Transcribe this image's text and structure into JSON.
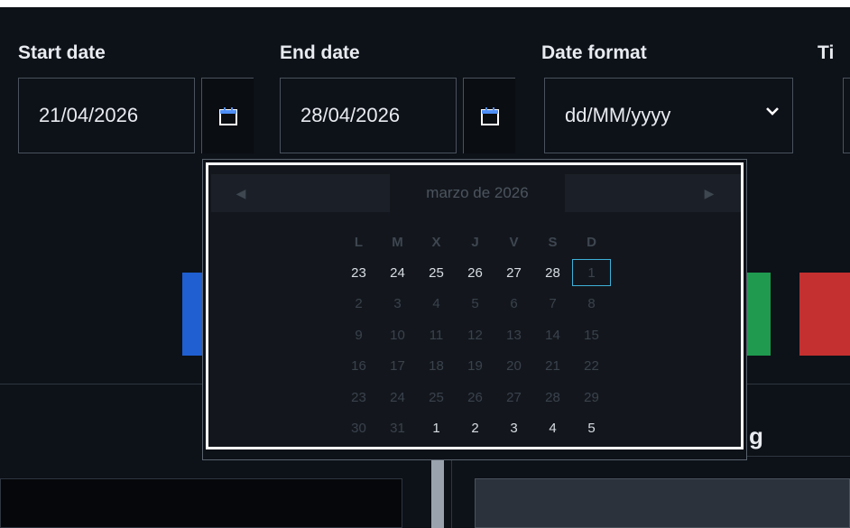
{
  "filters": {
    "start_date": {
      "label": "Start date",
      "value": "21/04/2026"
    },
    "end_date": {
      "label": "End date",
      "value": "28/04/2026"
    },
    "date_format": {
      "label": "Date format",
      "value": "dd/MM/yyyy"
    },
    "time_partial_label": "Ti"
  },
  "datepicker": {
    "month_label": "marzo de 2026",
    "weekdays": [
      "L",
      "M",
      "X",
      "J",
      "V",
      "S",
      "D"
    ],
    "weeks": [
      [
        {
          "d": "23",
          "m": "in"
        },
        {
          "d": "24",
          "m": "in"
        },
        {
          "d": "25",
          "m": "in"
        },
        {
          "d": "26",
          "m": "in"
        },
        {
          "d": "27",
          "m": "in"
        },
        {
          "d": "28",
          "m": "in"
        },
        {
          "d": "1",
          "m": "sel"
        }
      ],
      [
        {
          "d": "2",
          "m": "out"
        },
        {
          "d": "3",
          "m": "out"
        },
        {
          "d": "4",
          "m": "out"
        },
        {
          "d": "5",
          "m": "out"
        },
        {
          "d": "6",
          "m": "out"
        },
        {
          "d": "7",
          "m": "out"
        },
        {
          "d": "8",
          "m": "out"
        }
      ],
      [
        {
          "d": "9",
          "m": "out"
        },
        {
          "d": "10",
          "m": "out"
        },
        {
          "d": "11",
          "m": "out"
        },
        {
          "d": "12",
          "m": "out"
        },
        {
          "d": "13",
          "m": "out"
        },
        {
          "d": "14",
          "m": "out"
        },
        {
          "d": "15",
          "m": "out"
        }
      ],
      [
        {
          "d": "16",
          "m": "out"
        },
        {
          "d": "17",
          "m": "out"
        },
        {
          "d": "18",
          "m": "out"
        },
        {
          "d": "19",
          "m": "out"
        },
        {
          "d": "20",
          "m": "out"
        },
        {
          "d": "21",
          "m": "out"
        },
        {
          "d": "22",
          "m": "out"
        }
      ],
      [
        {
          "d": "23",
          "m": "out"
        },
        {
          "d": "24",
          "m": "out"
        },
        {
          "d": "25",
          "m": "out"
        },
        {
          "d": "26",
          "m": "out"
        },
        {
          "d": "27",
          "m": "out"
        },
        {
          "d": "28",
          "m": "out"
        },
        {
          "d": "29",
          "m": "out"
        }
      ],
      [
        {
          "d": "30",
          "m": "out"
        },
        {
          "d": "31",
          "m": "out"
        },
        {
          "d": "1",
          "m": "in"
        },
        {
          "d": "2",
          "m": "in"
        },
        {
          "d": "3",
          "m": "in"
        },
        {
          "d": "4",
          "m": "in"
        },
        {
          "d": "5",
          "m": "in"
        }
      ]
    ]
  },
  "section_tail_text": "g",
  "colors": {
    "background": "#0d1118",
    "blue_button": "#1f5fd1",
    "green_button": "#1f9a4f",
    "red_button": "#c43030",
    "selected_day_outline": "#3fb0d8"
  },
  "icons": {
    "calendar": "calendar-icon",
    "chevron": "chevron-down-icon",
    "prev": "triangle-left-icon",
    "next": "triangle-right-icon"
  }
}
